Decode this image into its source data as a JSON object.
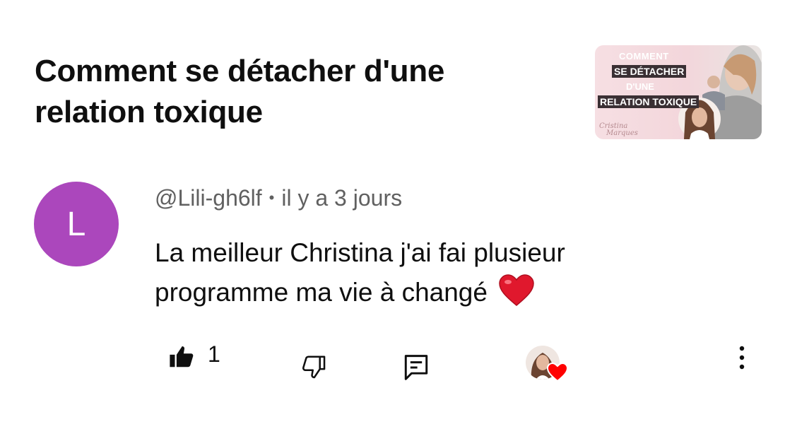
{
  "video": {
    "title": "Comment se détacher d'une relation toxique",
    "thumbnail": {
      "line1": "COMMENT",
      "line2": "SE DÉTACHER",
      "line3": "D'UNE",
      "line4": "RELATION TOXIQUE",
      "brand_line1": "Cristina",
      "brand_line2": "Marques",
      "accent_color": "#f3d6db"
    }
  },
  "comment": {
    "avatar_letter": "L",
    "avatar_color": "#ab47bc",
    "author": "@Lili-gh6lf",
    "separator": "•",
    "time": "il y a 3 jours",
    "text": "La meilleur Christina j'ai fai plusieur programme ma vie à changé",
    "emoji": "red-heart-emoji"
  },
  "actions": {
    "like_count": "1",
    "like_icon": "thumb-up-filled-icon",
    "dislike_icon": "thumb-down-icon",
    "reply_icon": "reply-comment-icon",
    "creator_heart_icon": "creator-heart-icon",
    "more_icon": "more-vertical-icon"
  }
}
